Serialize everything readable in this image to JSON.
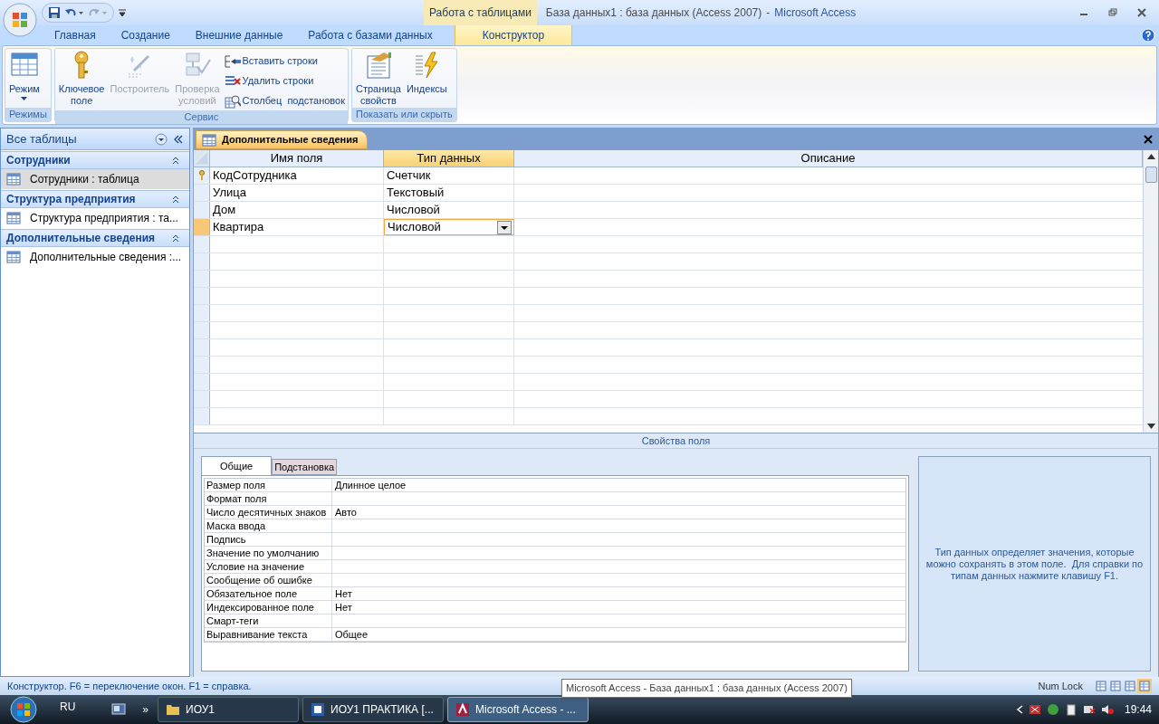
{
  "window": {
    "contextual_tab": "Работа с таблицами",
    "title": "База данных1 : база данных (Access 2007)",
    "separator": "-",
    "app": "Microsoft Access"
  },
  "ribbon_tabs": [
    {
      "label": "Главная",
      "selected": false
    },
    {
      "label": "Создание",
      "selected": false
    },
    {
      "label": "Внешние данные",
      "selected": false
    },
    {
      "label": "Работа с базами данных",
      "selected": false
    },
    {
      "label": "Конструктор",
      "selected": true
    }
  ],
  "ribbon_groups": [
    {
      "label": "Режимы",
      "buttons": [
        {
          "kind": "view",
          "lines": [
            "Режим"
          ],
          "disabled": false
        }
      ]
    },
    {
      "label": "Сервис",
      "buttons": [
        {
          "kind": "key",
          "lines": [
            "Ключевое",
            "поле"
          ],
          "disabled": false
        },
        {
          "kind": "builder",
          "lines": [
            "Построитель"
          ],
          "disabled": true
        },
        {
          "kind": "validate",
          "lines": [
            "Проверка",
            "условий"
          ],
          "disabled": true
        },
        {
          "kind": "insert",
          "lines": [
            "Вставить строки"
          ],
          "disabled": false
        },
        {
          "kind": "delete",
          "lines": [
            "Удалить строки"
          ],
          "disabled": false
        },
        {
          "kind": "lookup",
          "lines": [
            "Столбец  подстановок"
          ],
          "disabled": false
        }
      ]
    },
    {
      "label": "Показать или скрыть",
      "buttons": [
        {
          "kind": "sheet",
          "lines": [
            "Страница",
            "свойств"
          ],
          "disabled": false
        },
        {
          "kind": "indexes",
          "lines": [
            "Индексы"
          ],
          "disabled": false
        }
      ]
    }
  ],
  "navigation": {
    "header": "Все таблицы",
    "groups": [
      {
        "title": "Сотрудники",
        "items": [
          {
            "label": "Сотрудники : таблица",
            "selected": true
          }
        ]
      },
      {
        "title": "Структура предприятия",
        "items": [
          {
            "label": "Структура предприятия : та...",
            "selected": false
          }
        ]
      },
      {
        "title": "Дополнительные сведения",
        "items": [
          {
            "label": "Дополнительные сведения :...",
            "selected": false
          }
        ]
      }
    ]
  },
  "document_tab": "Дополнительные сведения",
  "design_grid": {
    "columns": [
      {
        "label": "Имя поля",
        "selected": false
      },
      {
        "label": "Тип данных",
        "selected": true
      },
      {
        "label": "Описание",
        "selected": false
      }
    ],
    "rows": [
      {
        "name": "КодСотрудника",
        "type": "Счетчик",
        "primary_key": true,
        "selected": false
      },
      {
        "name": "Улица",
        "type": "Текстовый",
        "primary_key": false,
        "selected": false
      },
      {
        "name": "Дом",
        "type": "Числовой",
        "primary_key": false,
        "selected": false
      },
      {
        "name": "Квартира",
        "type": "Числовой",
        "primary_key": false,
        "selected": true
      }
    ]
  },
  "properties": {
    "title": "Свойства поля",
    "tabs": [
      {
        "label": "Общие",
        "selected": true
      },
      {
        "label": "Подстановка",
        "selected": false
      }
    ],
    "rows": [
      {
        "label": "Размер поля",
        "value": "Длинное целое"
      },
      {
        "label": "Формат поля"
      },
      {
        "label": "Число десятичных знаков",
        "value": "Авто"
      },
      {
        "label": "Маска ввода"
      },
      {
        "label": "Подпись"
      },
      {
        "label": "Значение по умолчанию"
      },
      {
        "label": "Условие на значение"
      },
      {
        "label": "Сообщение об ошибке"
      },
      {
        "label": "Обязательное поле",
        "value": "Нет"
      },
      {
        "label": "Индексированное поле",
        "value": "Нет"
      },
      {
        "label": "Смарт-теги"
      },
      {
        "label": "Выравнивание текста",
        "value": "Общее"
      }
    ],
    "help": "Тип данных определяет значения, которые можно сохранять в этом поле.  Для справки по типам данных нажмите клавишу F1."
  },
  "status_bar": {
    "text": "Конструктор.  F6 = переключение окон.  F1 = справка.",
    "tooltip": "Microsoft Access - База данных1 : база данных (Access 2007)",
    "num_lock": "Num Lock"
  },
  "taskbar": {
    "language": "RU",
    "chevron": "»",
    "buttons": [
      {
        "kind": "folder",
        "label": "ИОУ1",
        "active": false
      },
      {
        "kind": "word",
        "label": "ИОУ1 ПРАКТИКА [...",
        "active": false
      },
      {
        "kind": "access",
        "label": "Microsoft Access - ...",
        "active": true
      }
    ],
    "clock": "19:44"
  }
}
